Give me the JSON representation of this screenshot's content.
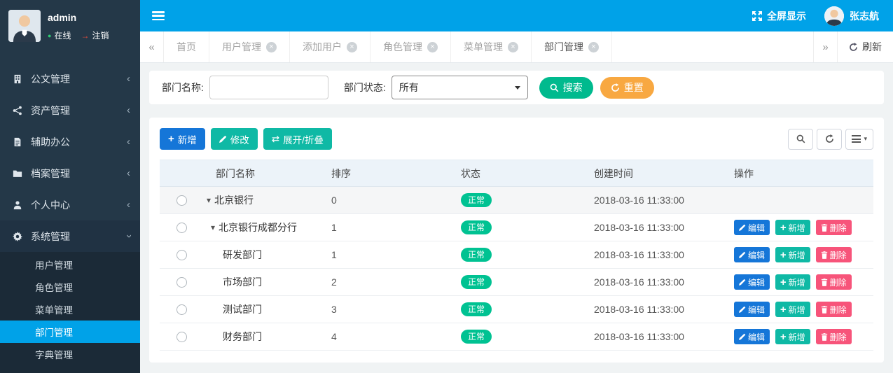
{
  "colors": {
    "topbar": "#00a2e8",
    "sidebar": "#243848",
    "sidebar_submenu": "#1b2a37",
    "active_item": "#00a2e8",
    "primary_button": "#1576d8",
    "teal_button": "#0fb9a5",
    "search_button": "#00ba8e",
    "reset_button": "#f8a841",
    "status_badge": "#00c292",
    "delete_button": "#f7547a"
  },
  "icons": {
    "collapse_left": "«",
    "collapse_right": "»",
    "chevron_left": "‹",
    "caret_down": "▾",
    "swap": "⇄",
    "plus": "+",
    "close": "×",
    "dot": "●",
    "logout_arrow": "→"
  },
  "sidebar": {
    "user": {
      "name": "admin",
      "online_label": "在线",
      "logout_label": "注销"
    },
    "items": [
      {
        "label": "公文管理"
      },
      {
        "label": "资产管理"
      },
      {
        "label": "辅助办公"
      },
      {
        "label": "档案管理"
      },
      {
        "label": "个人中心"
      },
      {
        "label": "系统管理"
      }
    ],
    "submenu": [
      {
        "label": "用户管理"
      },
      {
        "label": "角色管理"
      },
      {
        "label": "菜单管理"
      },
      {
        "label": "部门管理"
      },
      {
        "label": "字典管理"
      }
    ]
  },
  "topbar": {
    "fullscreen_label": "全屏显示",
    "user_name": "张志航"
  },
  "tabbar": {
    "tabs": [
      {
        "label": "首页"
      },
      {
        "label": "用户管理"
      },
      {
        "label": "添加用户"
      },
      {
        "label": "角色管理"
      },
      {
        "label": "菜单管理"
      },
      {
        "label": "部门管理"
      }
    ],
    "refresh_label": "刷新"
  },
  "filters": {
    "dept_name_label": "部门名称:",
    "dept_name_value": "",
    "dept_status_label": "部门状态:",
    "dept_status_value": "所有",
    "search_label": "搜索",
    "reset_label": "重置"
  },
  "toolbar": {
    "add_label": "新增",
    "edit_label": "修改",
    "toggle_label": "展开/折叠"
  },
  "table": {
    "headers": {
      "name": "部门名称",
      "order": "排序",
      "status": "状态",
      "created": "创建时间",
      "actions": "操作"
    },
    "actions": {
      "edit": "编辑",
      "add": "新增",
      "delete": "删除"
    },
    "rows": [
      {
        "name": "北京银行",
        "order": "0",
        "status": "正常",
        "created": "2018-03-16 11:33:00"
      },
      {
        "name": "北京银行成都分行",
        "order": "1",
        "status": "正常",
        "created": "2018-03-16 11:33:00"
      },
      {
        "name": "研发部门",
        "order": "1",
        "status": "正常",
        "created": "2018-03-16 11:33:00"
      },
      {
        "name": "市场部门",
        "order": "2",
        "status": "正常",
        "created": "2018-03-16 11:33:00"
      },
      {
        "name": "测试部门",
        "order": "3",
        "status": "正常",
        "created": "2018-03-16 11:33:00"
      },
      {
        "name": "财务部门",
        "order": "4",
        "status": "正常",
        "created": "2018-03-16 11:33:00"
      }
    ]
  }
}
